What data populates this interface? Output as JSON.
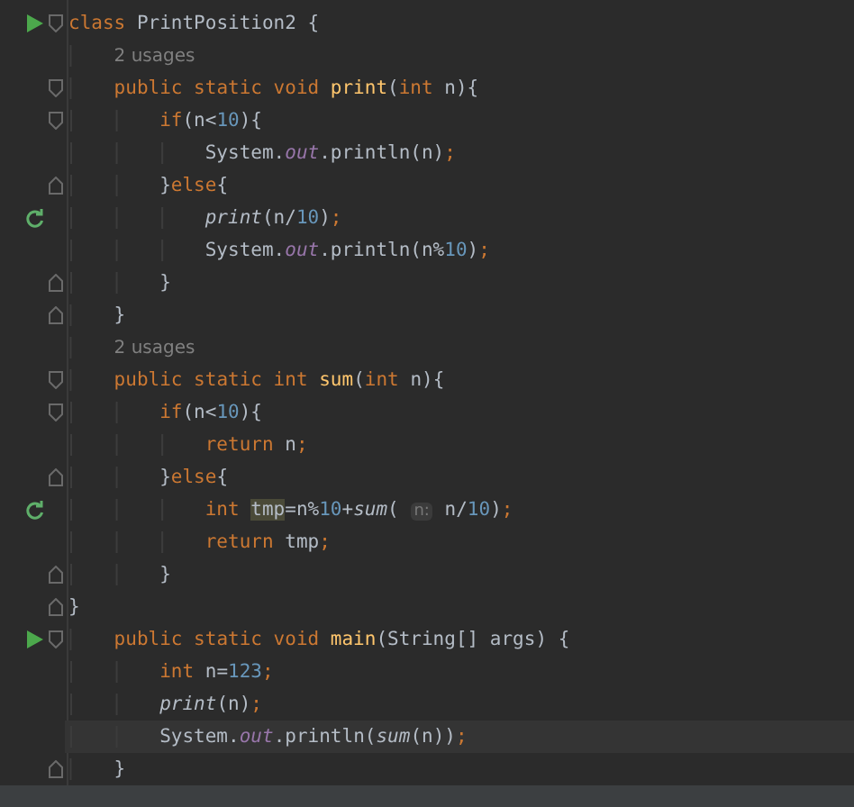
{
  "editor": {
    "lines": [
      {
        "runnable": true,
        "recursive": false,
        "fold_start": true,
        "fold_end": false,
        "current": false,
        "tokens": [
          {
            "text": "class ",
            "kind": "kw"
          },
          {
            "text": "PrintPosition2 {",
            "kind": "plain"
          }
        ]
      },
      {
        "runnable": false,
        "recursive": false,
        "fold_start": false,
        "fold_end": false,
        "current": false,
        "tokens": [
          {
            "text": "    2 usages",
            "kind": "usages"
          }
        ]
      },
      {
        "runnable": false,
        "recursive": false,
        "fold_start": true,
        "fold_end": false,
        "current": false,
        "tokens": [
          {
            "text": "    public static void ",
            "kind": "kw"
          },
          {
            "text": "print",
            "kind": "decl"
          },
          {
            "text": "(",
            "kind": "plain"
          },
          {
            "text": "int ",
            "kind": "kw"
          },
          {
            "text": "n){",
            "kind": "plain"
          }
        ]
      },
      {
        "runnable": false,
        "recursive": false,
        "fold_start": true,
        "fold_end": false,
        "current": false,
        "tokens": [
          {
            "text": "        if",
            "kind": "kw"
          },
          {
            "text": "(n<",
            "kind": "plain"
          },
          {
            "text": "10",
            "kind": "num"
          },
          {
            "text": "){",
            "kind": "plain"
          }
        ]
      },
      {
        "runnable": false,
        "recursive": false,
        "fold_start": false,
        "fold_end": false,
        "current": false,
        "tokens": [
          {
            "text": "            System.",
            "kind": "plain"
          },
          {
            "text": "out",
            "kind": "field"
          },
          {
            "text": ".println(n)",
            "kind": "plain"
          },
          {
            "text": ";",
            "kind": "kw"
          }
        ]
      },
      {
        "runnable": false,
        "recursive": false,
        "fold_start": false,
        "fold_end": true,
        "current": false,
        "tokens": [
          {
            "text": "        }",
            "kind": "plain"
          },
          {
            "text": "else",
            "kind": "kw"
          },
          {
            "text": "{",
            "kind": "plain"
          }
        ]
      },
      {
        "runnable": false,
        "recursive": true,
        "fold_start": false,
        "fold_end": false,
        "current": false,
        "tokens": [
          {
            "text": "            print",
            "kind": "call"
          },
          {
            "text": "(n/",
            "kind": "plain"
          },
          {
            "text": "10",
            "kind": "num"
          },
          {
            "text": ")",
            "kind": "plain"
          },
          {
            "text": ";",
            "kind": "kw"
          }
        ]
      },
      {
        "runnable": false,
        "recursive": false,
        "fold_start": false,
        "fold_end": false,
        "current": false,
        "tokens": [
          {
            "text": "            System.",
            "kind": "plain"
          },
          {
            "text": "out",
            "kind": "field"
          },
          {
            "text": ".println(n%",
            "kind": "plain"
          },
          {
            "text": "10",
            "kind": "num"
          },
          {
            "text": ")",
            "kind": "plain"
          },
          {
            "text": ";",
            "kind": "kw"
          }
        ]
      },
      {
        "runnable": false,
        "recursive": false,
        "fold_start": false,
        "fold_end": true,
        "current": false,
        "tokens": [
          {
            "text": "        }",
            "kind": "plain"
          }
        ]
      },
      {
        "runnable": false,
        "recursive": false,
        "fold_start": false,
        "fold_end": true,
        "current": false,
        "tokens": [
          {
            "text": "    }",
            "kind": "plain"
          }
        ]
      },
      {
        "runnable": false,
        "recursive": false,
        "fold_start": false,
        "fold_end": false,
        "current": false,
        "tokens": [
          {
            "text": "    2 usages",
            "kind": "usages"
          }
        ]
      },
      {
        "runnable": false,
        "recursive": false,
        "fold_start": true,
        "fold_end": false,
        "current": false,
        "tokens": [
          {
            "text": "    public static int ",
            "kind": "kw"
          },
          {
            "text": "sum",
            "kind": "decl"
          },
          {
            "text": "(",
            "kind": "plain"
          },
          {
            "text": "int ",
            "kind": "kw"
          },
          {
            "text": "n){",
            "kind": "plain"
          }
        ]
      },
      {
        "runnable": false,
        "recursive": false,
        "fold_start": true,
        "fold_end": false,
        "current": false,
        "tokens": [
          {
            "text": "        if",
            "kind": "kw"
          },
          {
            "text": "(n<",
            "kind": "plain"
          },
          {
            "text": "10",
            "kind": "num"
          },
          {
            "text": "){",
            "kind": "plain"
          }
        ]
      },
      {
        "runnable": false,
        "recursive": false,
        "fold_start": false,
        "fold_end": false,
        "current": false,
        "tokens": [
          {
            "text": "            return ",
            "kind": "kw"
          },
          {
            "text": "n",
            "kind": "plain"
          },
          {
            "text": ";",
            "kind": "kw"
          }
        ]
      },
      {
        "runnable": false,
        "recursive": false,
        "fold_start": false,
        "fold_end": true,
        "current": false,
        "tokens": [
          {
            "text": "        }",
            "kind": "plain"
          },
          {
            "text": "else",
            "kind": "kw"
          },
          {
            "text": "{",
            "kind": "plain"
          }
        ]
      },
      {
        "runnable": false,
        "recursive": true,
        "fold_start": false,
        "fold_end": false,
        "current": false,
        "tokens": [
          {
            "text": "            int ",
            "kind": "kw"
          },
          {
            "text": "tmp",
            "kind": "mark"
          },
          {
            "text": "=n%",
            "kind": "plain"
          },
          {
            "text": "10",
            "kind": "num"
          },
          {
            "text": "+",
            "kind": "plain"
          },
          {
            "text": "sum",
            "kind": "call"
          },
          {
            "text": "( ",
            "kind": "plain"
          },
          {
            "text": "n:",
            "kind": "inlay"
          },
          {
            "text": " n/",
            "kind": "plain"
          },
          {
            "text": "10",
            "kind": "num"
          },
          {
            "text": ")",
            "kind": "plain"
          },
          {
            "text": ";",
            "kind": "kw"
          }
        ]
      },
      {
        "runnable": false,
        "recursive": false,
        "fold_start": false,
        "fold_end": false,
        "current": false,
        "tokens": [
          {
            "text": "            return ",
            "kind": "kw"
          },
          {
            "text": "tmp",
            "kind": "plain"
          },
          {
            "text": ";",
            "kind": "kw"
          }
        ]
      },
      {
        "runnable": false,
        "recursive": false,
        "fold_start": false,
        "fold_end": true,
        "current": false,
        "tokens": [
          {
            "text": "        }",
            "kind": "plain"
          }
        ]
      },
      {
        "runnable": false,
        "recursive": false,
        "fold_start": false,
        "fold_end": true,
        "current": false,
        "tokens": [
          {
            "text": "}",
            "kind": "plain"
          }
        ]
      },
      {
        "runnable": true,
        "recursive": false,
        "fold_start": true,
        "fold_end": false,
        "current": false,
        "tokens": [
          {
            "text": "    public static void ",
            "kind": "kw"
          },
          {
            "text": "main",
            "kind": "decl"
          },
          {
            "text": "(String[] args) {",
            "kind": "plain"
          }
        ]
      },
      {
        "runnable": false,
        "recursive": false,
        "fold_start": false,
        "fold_end": false,
        "current": false,
        "tokens": [
          {
            "text": "        int ",
            "kind": "kw"
          },
          {
            "text": "n=",
            "kind": "plain"
          },
          {
            "text": "123",
            "kind": "num"
          },
          {
            "text": ";",
            "kind": "kw"
          }
        ]
      },
      {
        "runnable": false,
        "recursive": false,
        "fold_start": false,
        "fold_end": false,
        "current": false,
        "tokens": [
          {
            "text": "        print",
            "kind": "call"
          },
          {
            "text": "(n)",
            "kind": "plain"
          },
          {
            "text": ";",
            "kind": "kw"
          }
        ]
      },
      {
        "runnable": false,
        "recursive": false,
        "fold_start": false,
        "fold_end": false,
        "current": true,
        "tokens": [
          {
            "text": "        System.",
            "kind": "plain"
          },
          {
            "text": "out",
            "kind": "field"
          },
          {
            "text": ".println(",
            "kind": "plain"
          },
          {
            "text": "sum",
            "kind": "call"
          },
          {
            "text": "(n))",
            "kind": "plain"
          },
          {
            "text": ";",
            "kind": "kw"
          }
        ]
      },
      {
        "runnable": false,
        "recursive": false,
        "fold_start": false,
        "fold_end": true,
        "current": false,
        "tokens": [
          {
            "text": "    }",
            "kind": "plain"
          }
        ]
      }
    ]
  }
}
